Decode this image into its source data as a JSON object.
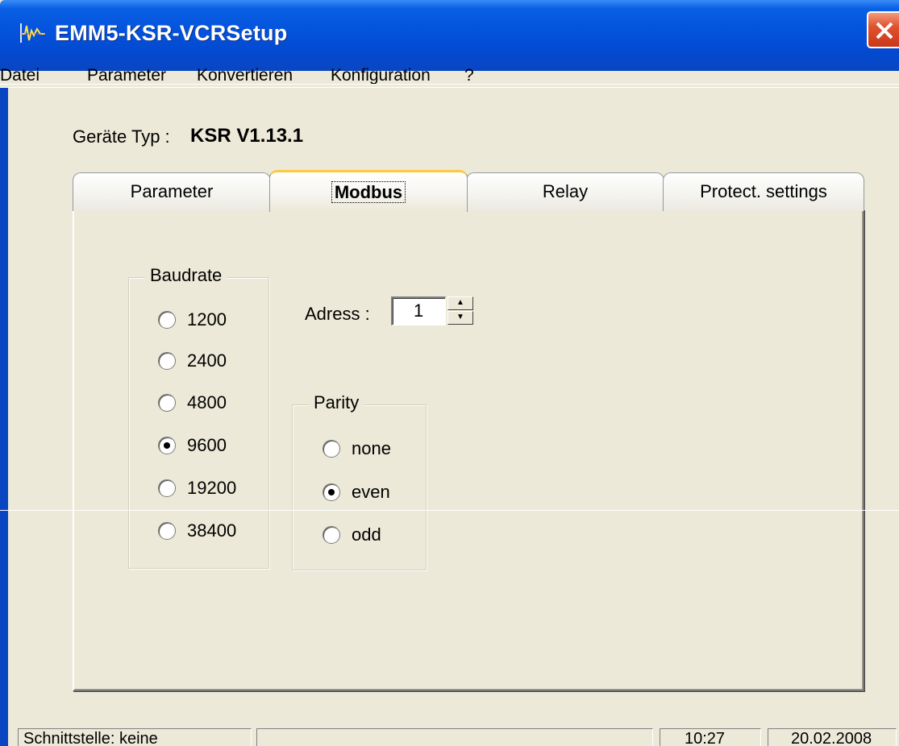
{
  "window": {
    "title": "EMM5-KSR-VCRSetup"
  },
  "menu": {
    "items": [
      "Datei",
      "Parameter",
      "Konvertieren",
      "Konfiguration",
      "?"
    ]
  },
  "device": {
    "label": "Geräte Typ :",
    "value": "KSR V1.13.1"
  },
  "tabs": [
    {
      "label": "Parameter"
    },
    {
      "label": "Modbus",
      "active": true
    },
    {
      "label": "Relay"
    },
    {
      "label": "Protect. settings"
    }
  ],
  "baudrate": {
    "legend": "Baudrate",
    "options": [
      "1200",
      "2400",
      "4800",
      "9600",
      "19200",
      "38400"
    ],
    "selected": "9600"
  },
  "address": {
    "label": "Adress :",
    "value": "1"
  },
  "parity": {
    "legend": "Parity",
    "options": [
      "none",
      "even",
      "odd"
    ],
    "selected": "even"
  },
  "statusbar": {
    "interface": "Schnittstelle: keine",
    "middle": "",
    "time": "10:27",
    "date": "20.02.2008"
  },
  "colors": {
    "titlebar": "#0454dd",
    "face": "#ece9d8",
    "tab_highlight": "#ffc83c",
    "close": "#e1522f"
  },
  "icons": {
    "app": "app-signal-icon",
    "close": "close-icon",
    "spin_up": "arrow-up-icon",
    "spin_down": "arrow-down-icon"
  }
}
